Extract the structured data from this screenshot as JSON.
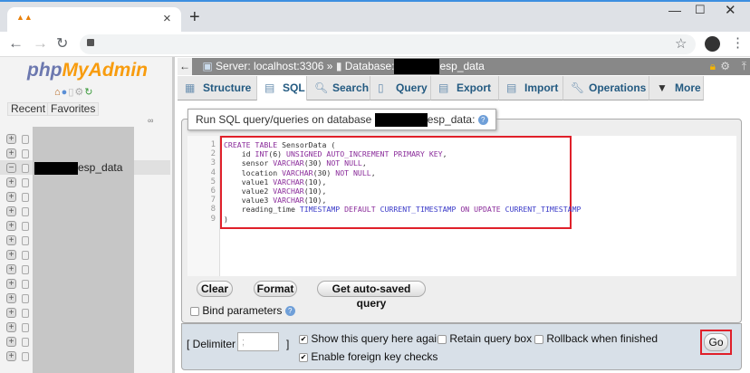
{
  "browser": {
    "tab_close": "×",
    "new_tab": "+"
  },
  "sidebar": {
    "logo_php": "php",
    "logo_myadmin": "MyAdmin",
    "recent": "Recent",
    "favorites": "Favorites",
    "selected_db_suffix": "esp_data",
    "tree_count": 16,
    "selected_index": 2
  },
  "breadcrumb": {
    "server": "Server: localhost:3306",
    "sep": "»",
    "database_label": "Database:",
    "database_suffix": "esp_data"
  },
  "tabs": [
    {
      "label": "Structure",
      "icon": "structure-icon"
    },
    {
      "label": "SQL",
      "icon": "sql-icon",
      "active": true
    },
    {
      "label": "Search",
      "icon": "search-icon"
    },
    {
      "label": "Query",
      "icon": "query-icon"
    },
    {
      "label": "Export",
      "icon": "export-icon"
    },
    {
      "label": "Import",
      "icon": "import-icon"
    },
    {
      "label": "Operations",
      "icon": "wrench-icon"
    },
    {
      "label": "More",
      "icon": "triangle-down-icon"
    }
  ],
  "sql": {
    "legend_prefix": "Run SQL query/queries on database",
    "legend_suffix": "esp_data:",
    "lines": [
      "CREATE TABLE SensorData (",
      "    id INT(6) UNSIGNED AUTO_INCREMENT PRIMARY KEY,",
      "    sensor VARCHAR(30) NOT NULL,",
      "    location VARCHAR(30) NOT NULL,",
      "    value1 VARCHAR(10),",
      "    value2 VARCHAR(10),",
      "    value3 VARCHAR(10),",
      "    reading_time TIMESTAMP DEFAULT CURRENT_TIMESTAMP ON UPDATE CURRENT_TIMESTAMP",
      ")"
    ],
    "clear": "Clear",
    "format": "Format",
    "autosaved": "Get auto-saved query",
    "bind_params": "Bind parameters"
  },
  "options": {
    "delimiter_label": "[ Delimiter",
    "delimiter_value": ";",
    "delimiter_close": "]",
    "show_query": "Show this query here again",
    "show_query_checked": true,
    "retain": "Retain query box",
    "retain_checked": false,
    "rollback": "Rollback when finished",
    "rollback_checked": false,
    "fk_checks": "Enable foreign key checks",
    "fk_checked": true,
    "go": "Go"
  }
}
